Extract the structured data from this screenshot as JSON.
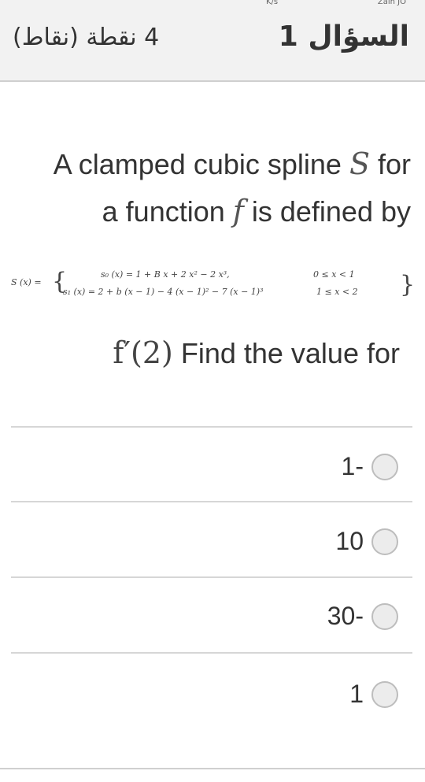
{
  "status_bar": {
    "speed": "K/s",
    "carrier": "Zain JO"
  },
  "header": {
    "question_label": "السؤال 1",
    "points_label": "4 نقطة (نقاط)"
  },
  "question": {
    "line1_prefix": "A clamped cubic spline ",
    "line1_var": "S",
    "line1_suffix": " for",
    "line2_prefix": "a function ",
    "line2_var": "f",
    "line2_suffix": " is defined by",
    "formula": {
      "lhs": "S (x) =",
      "row1": "s₀ (x) = 1 + B x + 2 x² − 2 x³,",
      "row2": "s₁ (x) = 2 + b (x − 1) − 4 (x − 1)² − 7 (x − 1)³",
      "cond1": "0 ≤ x < 1",
      "cond2": "1 ≤ x < 2"
    },
    "find_expr": "f′(2)",
    "find_text": " Find the value for"
  },
  "options": [
    {
      "label": "1-"
    },
    {
      "label": "10"
    },
    {
      "label": "30-"
    },
    {
      "label": "1"
    }
  ]
}
